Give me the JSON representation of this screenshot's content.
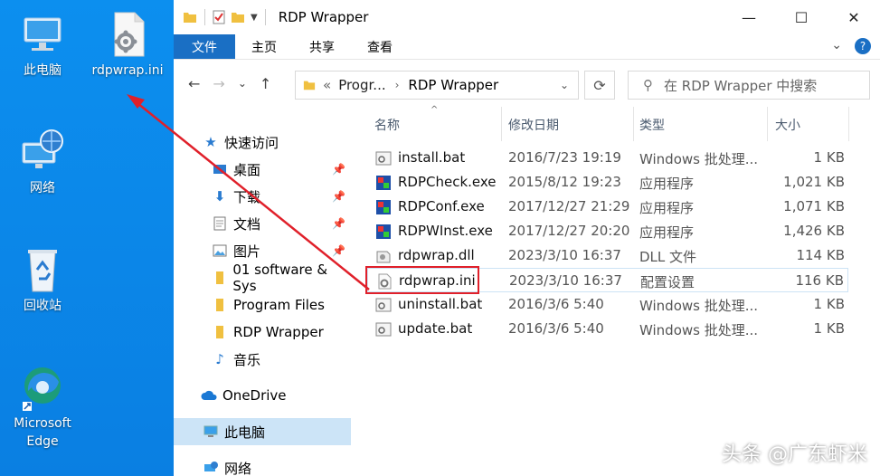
{
  "desktop": {
    "icons": [
      {
        "label": "此电脑",
        "icon": "computer-icon"
      },
      {
        "label": "rdpwrap.ini",
        "icon": "config-file-icon"
      },
      {
        "label": "网络",
        "icon": "network-icon"
      },
      {
        "label": "回收站",
        "icon": "recycle-bin-icon"
      },
      {
        "label": "Microsoft Edge",
        "icon": "edge-icon"
      }
    ]
  },
  "window": {
    "title": "RDP Wrapper",
    "controls": {
      "minimize": "—",
      "maximize": "☐",
      "close": "✕"
    }
  },
  "ribbon": {
    "tabs": [
      "文件",
      "主页",
      "共享",
      "查看"
    ]
  },
  "nav": {
    "back": "←",
    "forward": "→",
    "recent": "⌄",
    "up": "↑",
    "refresh": "⟳"
  },
  "address": {
    "prefix": "«",
    "crumbs": [
      "Progr...",
      "RDP Wrapper"
    ]
  },
  "search": {
    "placeholder": "在 RDP Wrapper 中搜索"
  },
  "navpane": {
    "quick_access": "快速访问",
    "items": [
      {
        "label": "桌面",
        "icon": "desktop-icon",
        "pinned": true
      },
      {
        "label": "下载",
        "icon": "download-icon",
        "pinned": true
      },
      {
        "label": "文档",
        "icon": "documents-icon",
        "pinned": true
      },
      {
        "label": "图片",
        "icon": "pictures-icon",
        "pinned": true
      },
      {
        "label": "01 software & Sys",
        "icon": "folder-icon",
        "pinned": false
      },
      {
        "label": "Program Files",
        "icon": "folder-icon",
        "pinned": false
      },
      {
        "label": "RDP Wrapper",
        "icon": "folder-icon",
        "pinned": false
      },
      {
        "label": "音乐",
        "icon": "music-icon",
        "pinned": false
      }
    ],
    "onedrive": "OneDrive",
    "this_pc": "此电脑",
    "network": "网络"
  },
  "filelist": {
    "columns": [
      "名称",
      "修改日期",
      "类型",
      "大小"
    ],
    "rows": [
      {
        "name": "install.bat",
        "date": "2016/7/23 19:19",
        "type": "Windows 批处理...",
        "size": "1 KB",
        "icon": "batch-file-icon"
      },
      {
        "name": "RDPCheck.exe",
        "date": "2015/8/12 19:23",
        "type": "应用程序",
        "size": "1,021 KB",
        "icon": "exe-file-icon"
      },
      {
        "name": "RDPConf.exe",
        "date": "2017/12/27 21:29",
        "type": "应用程序",
        "size": "1,071 KB",
        "icon": "exe-file-icon"
      },
      {
        "name": "RDPWInst.exe",
        "date": "2017/12/27 20:20",
        "type": "应用程序",
        "size": "1,426 KB",
        "icon": "exe-file-icon"
      },
      {
        "name": "rdpwrap.dll",
        "date": "2023/3/10 16:37",
        "type": "DLL 文件",
        "size": "114 KB",
        "icon": "dll-file-icon"
      },
      {
        "name": "rdpwrap.ini",
        "date": "2023/3/10 16:37",
        "type": "配置设置",
        "size": "116 KB",
        "icon": "config-file-icon"
      },
      {
        "name": "uninstall.bat",
        "date": "2016/3/6 5:40",
        "type": "Windows 批处理...",
        "size": "1 KB",
        "icon": "batch-file-icon"
      },
      {
        "name": "update.bat",
        "date": "2016/3/6 5:40",
        "type": "Windows 批处理...",
        "size": "1 KB",
        "icon": "batch-file-icon"
      }
    ]
  },
  "watermark": "头条 @广东虾米",
  "colors": {
    "desktop": "#0a84e8",
    "ribbon_file": "#1a6fc4",
    "highlight_red": "#e0202a",
    "selection": "#cce4f7"
  }
}
